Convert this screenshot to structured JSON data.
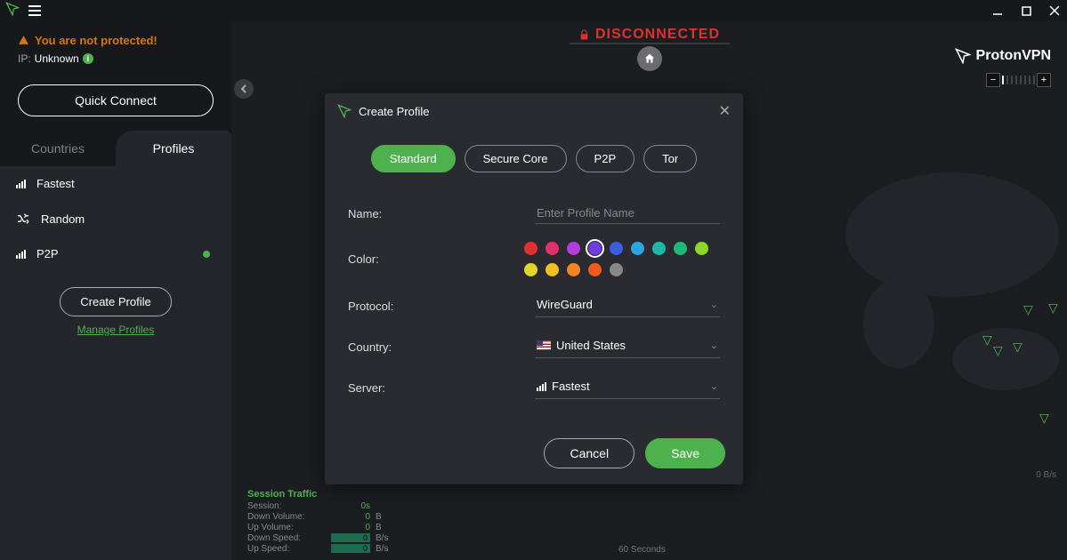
{
  "brand": "ProtonVPN",
  "status": {
    "warning": "You are not protected!",
    "ip_label": "IP:",
    "ip_value": "Unknown",
    "disconnected": "DISCONNECTED"
  },
  "sidebar": {
    "quick_connect": "Quick Connect",
    "tabs": {
      "countries": "Countries",
      "profiles": "Profiles"
    },
    "profiles": [
      {
        "label": "Fastest",
        "icon": "signal"
      },
      {
        "label": "Random",
        "icon": "shuffle"
      },
      {
        "label": "P2P",
        "icon": "signal",
        "dot": true
      }
    ],
    "create_profile": "Create Profile",
    "manage_profiles": "Manage Profiles"
  },
  "stats": {
    "title": "Session Traffic",
    "session_label": "Session:",
    "session_value": "0s",
    "downvol_label": "Down Volume:",
    "downvol_value": "0",
    "downvol_unit": "B",
    "upvol_label": "Up Volume:",
    "upvol_value": "0",
    "upvol_unit": "B",
    "downspd_label": "Down Speed:",
    "downspd_value": "0",
    "downspd_unit": "B/s",
    "upspd_label": "Up Speed:",
    "upspd_value": "0",
    "upspd_unit": "B/s",
    "seconds_label": "60 Seconds",
    "axis_label": "0 B/s"
  },
  "modal": {
    "title": "Create Profile",
    "types": [
      "Standard",
      "Secure Core",
      "P2P",
      "Tor"
    ],
    "active_type": 0,
    "labels": {
      "name": "Name:",
      "color": "Color:",
      "protocol": "Protocol:",
      "country": "Country:",
      "server": "Server:"
    },
    "name_placeholder": "Enter Profile Name",
    "colors": [
      "#e03131",
      "#e0316e",
      "#b23ddb",
      "#6e3de0",
      "#3d5de0",
      "#2aa5e0",
      "#1fb8a6",
      "#1fb87a",
      "#8dd62a",
      "#e0d62a",
      "#f2c01f",
      "#f2851f",
      "#f25a1f",
      "#888888"
    ],
    "selected_color": 3,
    "protocol_value": "WireGuard",
    "country_value": "United States",
    "server_value": "Fastest",
    "cancel": "Cancel",
    "save": "Save"
  }
}
